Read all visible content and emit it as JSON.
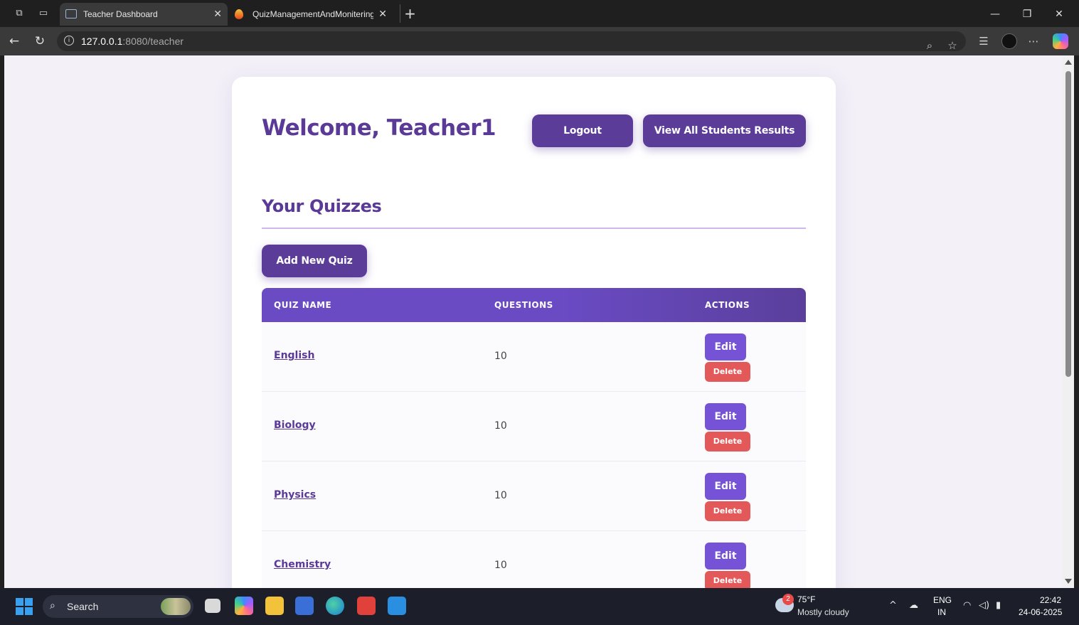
{
  "browser": {
    "tabs": [
      {
        "title": "Teacher Dashboard",
        "active": true
      },
      {
        "title": "QuizManagementAndMonitering",
        "active": false
      }
    ],
    "tab_close_glyph": "✕",
    "new_tab_glyph": "+",
    "url_host": "127.0.0.1",
    "url_rest": ":8080/teacher",
    "window_controls": [
      "—",
      "❐",
      "✕"
    ],
    "icons": [
      "workspaces-icon",
      "tab-actions-icon",
      "back-icon",
      "refresh-icon",
      "site-info-icon",
      "zoom-icon",
      "favorite-star-icon",
      "favorites-icon",
      "profile-icon",
      "more-icon",
      "copilot-icon"
    ]
  },
  "page": {
    "welcome": "Welcome, Teacher1",
    "logout_label": "Logout",
    "view_results_label": "View All Students Results",
    "section_title": "Your Quizzes",
    "add_quiz_label": "Add New Quiz",
    "table": {
      "headers": {
        "name": "QUIZ NAME",
        "questions": "QUESTIONS",
        "actions": "ACTIONS"
      },
      "rows": [
        {
          "name": "English",
          "questions": "10"
        },
        {
          "name": "Biology",
          "questions": "10"
        },
        {
          "name": "Physics",
          "questions": "10"
        },
        {
          "name": "Chemistry",
          "questions": "10"
        }
      ],
      "edit_label": "Edit",
      "delete_label": "Delete"
    },
    "colors": {
      "brand": "#5b3c98",
      "header": "#6a4bc4",
      "edit": "#7653d6",
      "delete": "#e35959",
      "divider": "#cdb8ee"
    }
  },
  "taskbar": {
    "search_label": "Search",
    "weather_badge": "2",
    "weather_temp": "75°F",
    "weather_desc": "Mostly cloudy",
    "lang_top": "ENG",
    "lang_bottom": "IN",
    "time": "22:42",
    "date": "24-06-2025"
  }
}
